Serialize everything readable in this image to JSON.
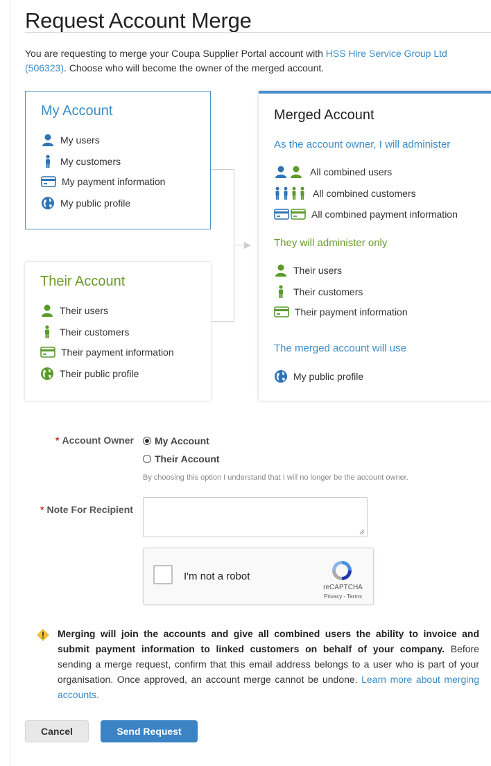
{
  "page": {
    "title": "Request Account Merge",
    "intro_prefix": "You are requesting to merge your Coupa Supplier Portal account with ",
    "intro_link": "HSS Hire Service Group Ltd (506323)",
    "intro_suffix": ". Choose who will become the owner of the merged account."
  },
  "my_account": {
    "title": "My Account",
    "items": [
      {
        "label": "My users",
        "icon": "user-icon"
      },
      {
        "label": "My customers",
        "icon": "customer-icon"
      },
      {
        "label": "My payment information",
        "icon": "payment-card-icon"
      },
      {
        "label": "My public profile",
        "icon": "globe-icon"
      }
    ]
  },
  "their_account": {
    "title": "Their Account",
    "items": [
      {
        "label": "Their users",
        "icon": "user-icon"
      },
      {
        "label": "Their customers",
        "icon": "customer-icon"
      },
      {
        "label": "Their payment information",
        "icon": "payment-card-icon"
      },
      {
        "label": "Their public profile",
        "icon": "globe-icon"
      }
    ]
  },
  "merged_account": {
    "title": "Merged Account",
    "owner_heading": "As the account owner, I will administer",
    "owner_items": [
      "All combined users",
      "All combined customers",
      "All combined payment information"
    ],
    "they_heading": "They will administer only",
    "they_items": [
      "Their users",
      "Their customers",
      "Their payment information"
    ],
    "use_heading": "The merged account will use",
    "use_items": [
      "My public profile"
    ]
  },
  "form": {
    "required_mark": "*",
    "owner_label": "Account Owner",
    "options": [
      "My Account",
      "Their Account"
    ],
    "selected_option": "My Account",
    "owner_hint": "By choosing this option I understand that I will no longer be the account owner.",
    "note_label": "Note For Recipient",
    "note_value": ""
  },
  "captcha": {
    "label": "I'm not a robot",
    "brand": "reCAPTCHA",
    "links": "Privacy - Terms"
  },
  "warning": {
    "bold_text": "Merging will join the accounts and give all combined users the ability to invoice and submit payment information to linked customers on behalf of your company.",
    "text": " Before sending a merge request, confirm that this email address belongs to a user who is part of your organisation. Once approved, an account merge cannot be undone. ",
    "link": "Learn more about merging accounts."
  },
  "buttons": {
    "cancel": "Cancel",
    "send": "Send Request"
  },
  "colors": {
    "link_blue": "#3a8cc7",
    "my_blue": "#2f74b5",
    "their_green": "#6a9a2a",
    "primary_button": "#3b83c4",
    "warning_yellow": "#f4c430"
  }
}
